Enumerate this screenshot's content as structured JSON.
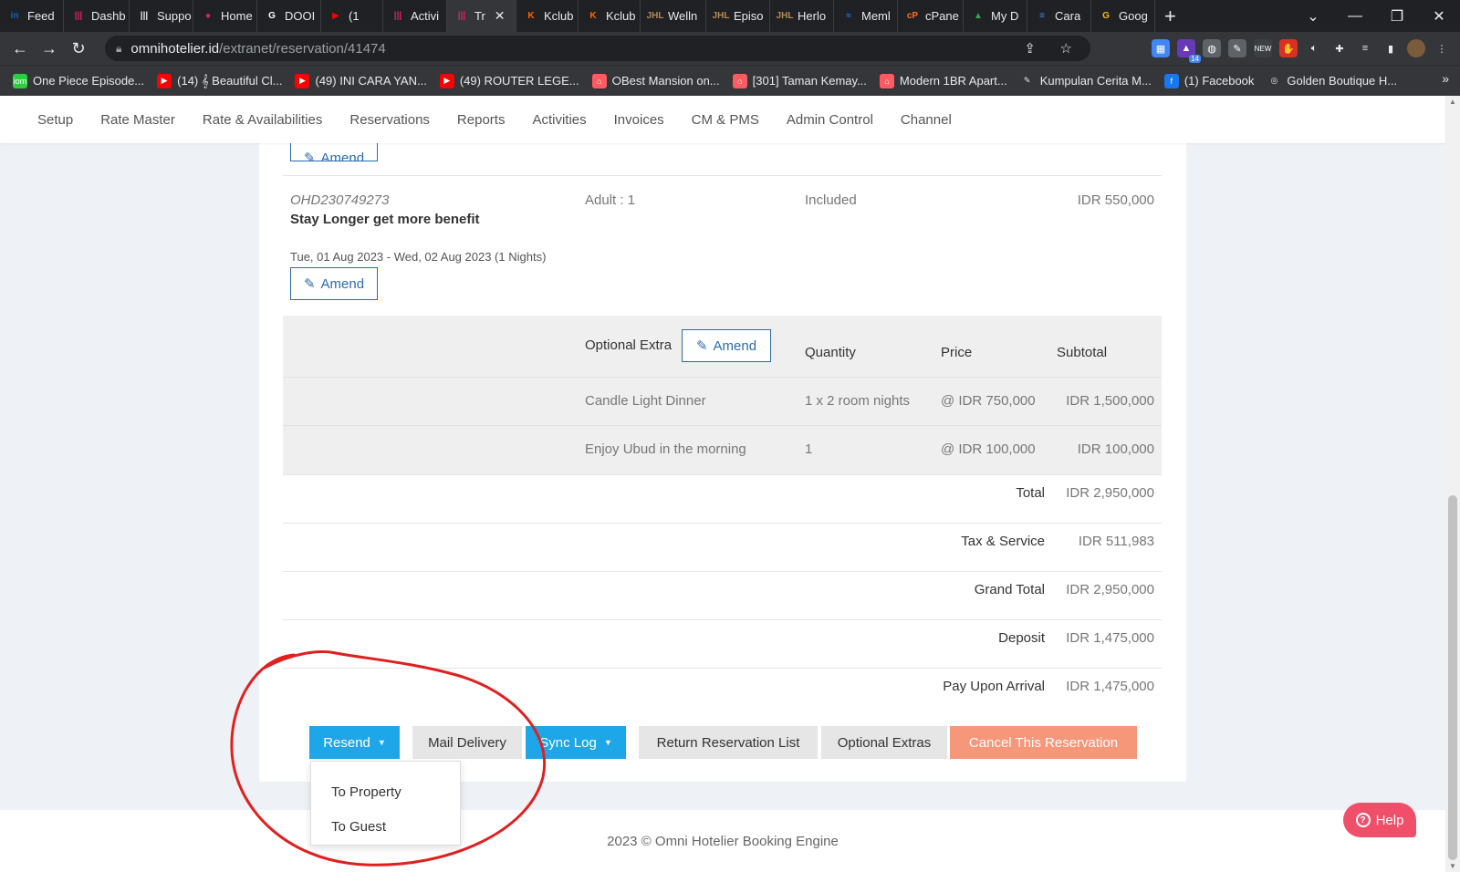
{
  "browser": {
    "tabs": [
      {
        "label": "Feed",
        "color": "#0a66c2",
        "glyph": "in"
      },
      {
        "label": "Dashb",
        "color": "#e0245e",
        "glyph": "|||"
      },
      {
        "label": "Suppo",
        "color": "#e8eaed",
        "glyph": "|||"
      },
      {
        "label": "Home",
        "color": "#e0245e",
        "glyph": "●"
      },
      {
        "label": "DOOI",
        "color": "#ffffff",
        "glyph": "G"
      },
      {
        "label": "(1",
        "color": "#ff0000",
        "glyph": "▶"
      },
      {
        "label": "Activi",
        "color": "#e0245e",
        "glyph": "|||"
      },
      {
        "label": "Tr",
        "color": "#e0245e",
        "glyph": "|||",
        "active": true
      },
      {
        "label": "Kclub",
        "color": "#ff6600",
        "glyph": "K"
      },
      {
        "label": "Kclub",
        "color": "#ff6600",
        "glyph": "K"
      },
      {
        "label": "Welln",
        "color": "#b38b59",
        "glyph": "JHL"
      },
      {
        "label": "Episo",
        "color": "#b38b59",
        "glyph": "JHL"
      },
      {
        "label": "Herlo",
        "color": "#b38b59",
        "glyph": "JHL"
      },
      {
        "label": "Meml",
        "color": "#1877f2",
        "glyph": "≈"
      },
      {
        "label": "cPane",
        "color": "#ff6c2c",
        "glyph": "cP"
      },
      {
        "label": "My D",
        "color": "#34a853",
        "glyph": "▲"
      },
      {
        "label": "Cara",
        "color": "#4285f4",
        "glyph": "≡"
      },
      {
        "label": "Goog",
        "color": "#fbbc04",
        "glyph": "G"
      }
    ],
    "url_host": "omnihotelier.id",
    "url_path": "/extranet/reservation/41474",
    "bookmarks": [
      {
        "label": "One Piece Episode...",
        "color": "#2ecc40",
        "glyph": "iom"
      },
      {
        "label": "(14) 𝄞 Beautiful Cl...",
        "color": "#ff0000",
        "glyph": "▶"
      },
      {
        "label": "(49) INI CARA YAN...",
        "color": "#ff0000",
        "glyph": "▶"
      },
      {
        "label": "(49) ROUTER LEGE...",
        "color": "#ff0000",
        "glyph": "▶"
      },
      {
        "label": "⭘Best Mansion on...",
        "color": "#ff5a5f",
        "glyph": "⌂"
      },
      {
        "label": "[301] Taman Kemay...",
        "color": "#ff5a5f",
        "glyph": "⌂"
      },
      {
        "label": "Modern 1BR Apart...",
        "color": "#ff5a5f",
        "glyph": "⌂"
      },
      {
        "label": "Kumpulan Cerita M...",
        "color": "#ffffff",
        "glyph": "✎"
      },
      {
        "label": "(1) Facebook",
        "color": "#1877f2",
        "glyph": "f"
      },
      {
        "label": "Golden Boutique H...",
        "color": "#ffffff",
        "glyph": "◎"
      }
    ],
    "ext_badge": "14"
  },
  "nav": {
    "items": [
      "Setup",
      "Rate Master",
      "Rate & Availabilities",
      "Reservations",
      "Reports",
      "Activities",
      "Invoices",
      "CM & PMS",
      "Admin Control",
      "Channel"
    ]
  },
  "room": {
    "top_amend_label": "Amend",
    "code": "OHD230749273",
    "rate_name": "Stay Longer get more benefit",
    "occupancy": "Adult : 1",
    "meal": "Included",
    "amount": "IDR 550,000",
    "dates": "Tue, 01 Aug 2023 - Wed, 02 Aug 2023 (1 Nights)",
    "amend_label": "Amend"
  },
  "extras": {
    "header_label": "Optional Extra",
    "amend_label": "Amend",
    "col_quantity": "Quantity",
    "col_price": "Price",
    "col_subtotal": "Subtotal",
    "rows": [
      {
        "name": "Candle Light Dinner",
        "quantity": "1 x 2 room nights",
        "price": "@ IDR 750,000",
        "subtotal": "IDR 1,500,000"
      },
      {
        "name": "Enjoy Ubud in the morning",
        "quantity": "1",
        "price": "@ IDR 100,000",
        "subtotal": "IDR 100,000"
      }
    ]
  },
  "totals": [
    {
      "label": "Total",
      "value": "IDR 2,950,000"
    },
    {
      "label": "Tax & Service",
      "value": "IDR 511,983"
    },
    {
      "label": "Grand Total",
      "value": "IDR 2,950,000"
    },
    {
      "label": "Deposit",
      "value": "IDR 1,475,000"
    },
    {
      "label": "Pay Upon Arrival",
      "value": "IDR 1,475,000"
    }
  ],
  "actions": {
    "resend": "Resend",
    "mail_delivery": "Mail Delivery",
    "sync_log": "Sync Log",
    "return_list": "Return Reservation List",
    "optional_extras": "Optional Extras",
    "cancel": "Cancel This Reservation",
    "resend_menu": [
      "To Property",
      "To Guest"
    ]
  },
  "footer": {
    "text": "2023 © Omni Hotelier Booking Engine"
  },
  "help": {
    "label": "Help"
  },
  "colors": {
    "primary": "#1ea7e8",
    "cancel": "#f7977a",
    "accent": "#2b6cb0",
    "help": "#f04f6a",
    "annotation": "#e02020"
  }
}
